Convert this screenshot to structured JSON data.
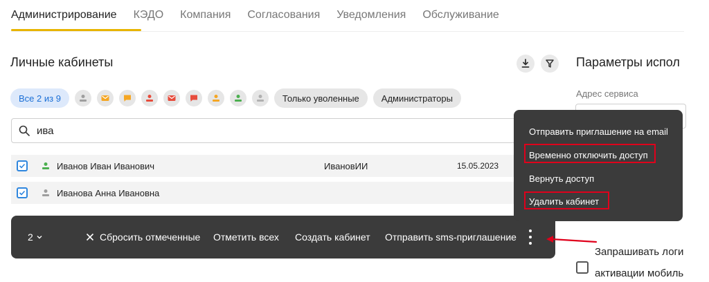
{
  "tabs": [
    {
      "label": "Администрирование",
      "active": true
    },
    {
      "label": "КЭДО"
    },
    {
      "label": "Компания"
    },
    {
      "label": "Согласования"
    },
    {
      "label": "Уведомления"
    },
    {
      "label": "Обслуживание"
    }
  ],
  "section": {
    "title": "Личные кабинеты",
    "download_icon": "download-icon",
    "filter_icon": "filter-icon"
  },
  "chips": {
    "all": "Все 2 из 9",
    "fired_only": "Только уволенные",
    "admins": "Администраторы",
    "status_icons": [
      {
        "icon": "person-icon",
        "color": "#9e9e9e"
      },
      {
        "icon": "email-icon",
        "color": "#f5a623"
      },
      {
        "icon": "chat-icon",
        "color": "#f5a623"
      },
      {
        "icon": "person-icon",
        "color": "#e74c3c"
      },
      {
        "icon": "email-icon",
        "color": "#e74c3c"
      },
      {
        "icon": "chat-icon",
        "color": "#e74c3c"
      },
      {
        "icon": "person-icon",
        "color": "#f5a623"
      },
      {
        "icon": "person-icon",
        "color": "#4caf50"
      },
      {
        "icon": "person-icon",
        "color": "#b0b0b0"
      }
    ]
  },
  "search": {
    "value": "ива"
  },
  "rows": [
    {
      "name": "Иванов Иван Иванович",
      "login": "ИвановИИ",
      "date": "15.05.2023",
      "checked": true,
      "person_color": "#4caf50"
    },
    {
      "name": "Иванова Анна Ивановна",
      "login": "",
      "date": "",
      "checked": true,
      "person_color": "#9e9e9e"
    }
  ],
  "action_bar": {
    "count": "2",
    "reset": "Сбросить отмеченные",
    "select_all": "Отметить всех",
    "create": "Создать кабинет",
    "send_sms": "Отправить sms-приглашение"
  },
  "menu": {
    "items": [
      "Отправить приглашение на email",
      "Временно отключить доступ",
      "Вернуть доступ",
      "Удалить кабинет"
    ]
  },
  "right_panel": {
    "title": "Параметры испол",
    "service_address_label": "Адрес сервиса",
    "check_label_1": "Запрашивать логи",
    "check_label_2": "активации мобиль"
  },
  "colors": {
    "accent": "#e8b400",
    "highlight": "#e0001b",
    "primary": "#1a6fd6"
  }
}
